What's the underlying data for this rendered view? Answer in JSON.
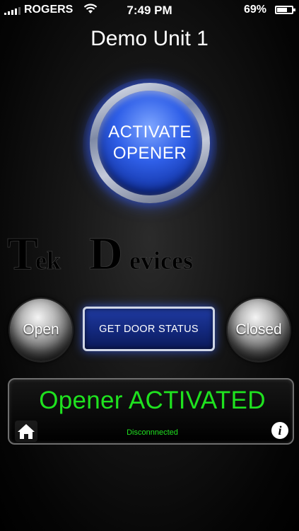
{
  "status_bar": {
    "carrier": "ROGERS",
    "time": "7:49 PM",
    "battery_percent": "69%",
    "battery_level": 0.69,
    "signal_icon": "signal-bars-icon",
    "wifi_icon": "wifi-icon"
  },
  "header": {
    "title": "Demo Unit 1"
  },
  "activate_button": {
    "line1": "ACTIVATE",
    "line2": "OPENER"
  },
  "logo": {
    "text_tek": "Tek",
    "text_devices": "Devices"
  },
  "controls": {
    "open_label": "Open",
    "closed_label": "Closed",
    "status_label": "GET DOOR STATUS"
  },
  "display": {
    "message": "Opener ACTIVATED",
    "connection": "Disconnnected",
    "home_icon": "home-icon",
    "info_icon": "info-icon"
  },
  "colors": {
    "accent_blue": "#2f5fe8",
    "display_green": "#1fe21f"
  }
}
